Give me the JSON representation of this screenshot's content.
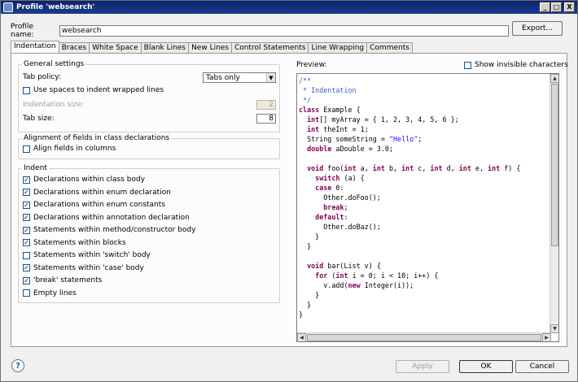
{
  "window": {
    "title": "Profile 'websearch'"
  },
  "window_controls": {
    "minimize": "_",
    "maximize": "□",
    "close": "X"
  },
  "profile": {
    "label": "Profile name:",
    "value": "websearch",
    "export_label": "Export..."
  },
  "tabs": [
    {
      "label": "Indentation",
      "active": true
    },
    {
      "label": "Braces"
    },
    {
      "label": "White Space"
    },
    {
      "label": "Blank Lines"
    },
    {
      "label": "New Lines"
    },
    {
      "label": "Control Statements"
    },
    {
      "label": "Line Wrapping"
    },
    {
      "label": "Comments"
    }
  ],
  "general": {
    "legend": "General settings",
    "tab_policy_label": "Tab policy:",
    "tab_policy_value": "Tabs only",
    "spaces_wrapped_label": "Use spaces to indent wrapped lines",
    "spaces_wrapped_checked": false,
    "indent_size_label": "Indentation size:",
    "indent_size_value": "2",
    "tab_size_label": "Tab size:",
    "tab_size_value": "8"
  },
  "alignment": {
    "legend": "Alignment of fields in class declarations",
    "align_label": "Align fields in columns",
    "align_checked": false
  },
  "indent": {
    "legend": "Indent",
    "items": [
      {
        "label": "Declarations within class body",
        "checked": true
      },
      {
        "label": "Declarations within enum declaration",
        "checked": true
      },
      {
        "label": "Declarations within enum constants",
        "checked": true
      },
      {
        "label": "Declarations within annotation declaration",
        "checked": true
      },
      {
        "label": "Statements within method/constructor body",
        "checked": true
      },
      {
        "label": "Statements within blocks",
        "checked": true
      },
      {
        "label": "Statements within 'switch' body",
        "checked": false
      },
      {
        "label": "Statements within 'case' body",
        "checked": true
      },
      {
        "label": "'break' statements",
        "checked": true
      },
      {
        "label": "Empty lines",
        "checked": false
      }
    ]
  },
  "preview": {
    "label": "Preview:",
    "show_invisible_label": "Show invisible characters",
    "show_invisible_checked": false,
    "code": [
      [
        [
          "cm",
          "/**"
        ]
      ],
      [
        [
          "cm",
          " * Indentation"
        ]
      ],
      [
        [
          "cm",
          " */"
        ]
      ],
      [
        [
          "kw",
          "class"
        ],
        [
          "",
          " Example {"
        ]
      ],
      [
        [
          "",
          "  "
        ],
        [
          "kw",
          "int"
        ],
        [
          "",
          "[] myArray = { 1, 2, 3, 4, 5, 6 };"
        ]
      ],
      [
        [
          "",
          "  "
        ],
        [
          "kw",
          "int"
        ],
        [
          "",
          " theInt = 1;"
        ]
      ],
      [
        [
          "",
          "  String someString = "
        ],
        [
          "st",
          "\"Hello\""
        ],
        [
          "",
          ";"
        ]
      ],
      [
        [
          "",
          "  "
        ],
        [
          "kw",
          "double"
        ],
        [
          "",
          " aDouble = 3.0;"
        ]
      ],
      [
        [
          "",
          ""
        ]
      ],
      [
        [
          "",
          "  "
        ],
        [
          "kw",
          "void"
        ],
        [
          "",
          " foo("
        ],
        [
          "kw",
          "int"
        ],
        [
          "",
          " a, "
        ],
        [
          "kw",
          "int"
        ],
        [
          "",
          " b, "
        ],
        [
          "kw",
          "int"
        ],
        [
          "",
          " c, "
        ],
        [
          "kw",
          "int"
        ],
        [
          "",
          " d, "
        ],
        [
          "kw",
          "int"
        ],
        [
          "",
          " e, "
        ],
        [
          "kw",
          "int"
        ],
        [
          "",
          " f) {"
        ]
      ],
      [
        [
          "",
          "    "
        ],
        [
          "kw",
          "switch"
        ],
        [
          "",
          " (a) {"
        ]
      ],
      [
        [
          "",
          "    "
        ],
        [
          "kw",
          "case"
        ],
        [
          "",
          " 0:"
        ]
      ],
      [
        [
          "",
          "      Other.doFoo();"
        ]
      ],
      [
        [
          "",
          "      "
        ],
        [
          "kw",
          "break"
        ],
        [
          "",
          ";"
        ]
      ],
      [
        [
          "",
          "    "
        ],
        [
          "kw",
          "default"
        ],
        [
          "",
          ":"
        ]
      ],
      [
        [
          "",
          "      Other.doBaz();"
        ]
      ],
      [
        [
          "",
          "    }"
        ]
      ],
      [
        [
          "",
          "  }"
        ]
      ],
      [
        [
          "",
          ""
        ]
      ],
      [
        [
          "",
          "  "
        ],
        [
          "kw",
          "void"
        ],
        [
          "",
          " bar(List v) {"
        ]
      ],
      [
        [
          "",
          "    "
        ],
        [
          "kw",
          "for"
        ],
        [
          "",
          " ("
        ],
        [
          "kw",
          "int"
        ],
        [
          "",
          " i = 0; i < 10; i++) {"
        ]
      ],
      [
        [
          "",
          "      v.add("
        ],
        [
          "kw",
          "new"
        ],
        [
          "",
          " Integer(i));"
        ]
      ],
      [
        [
          "",
          "    }"
        ]
      ],
      [
        [
          "",
          "  }"
        ]
      ],
      [
        [
          "",
          "}"
        ]
      ]
    ]
  },
  "footer": {
    "help_glyph": "?",
    "apply_label": "Apply",
    "ok_label": "OK",
    "cancel_label": "Cancel"
  },
  "colors": {
    "title_bar": "#0a246a",
    "keyword": "#7f0055",
    "comment": "#3f5fbf",
    "string": "#2a00ff"
  }
}
